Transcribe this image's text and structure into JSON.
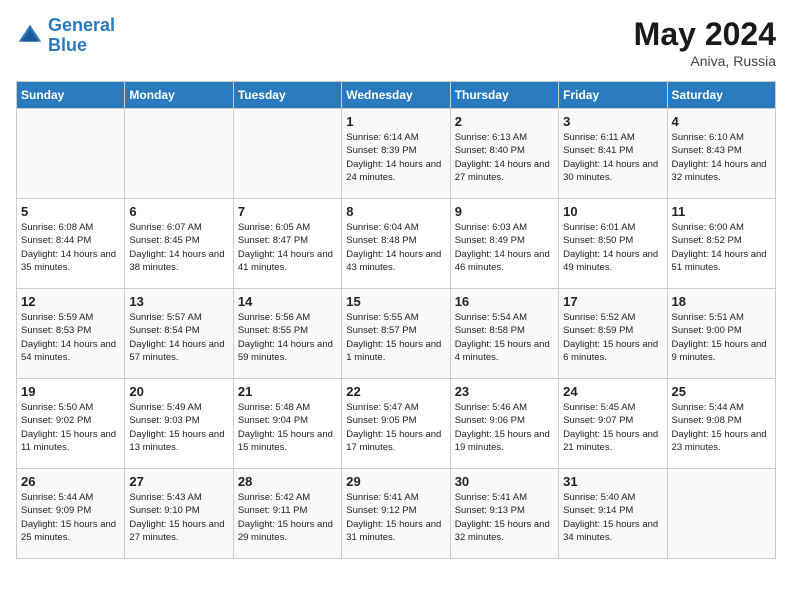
{
  "header": {
    "logo_line1": "General",
    "logo_line2": "Blue",
    "month_year": "May 2024",
    "location": "Aniva, Russia"
  },
  "days_of_week": [
    "Sunday",
    "Monday",
    "Tuesday",
    "Wednesday",
    "Thursday",
    "Friday",
    "Saturday"
  ],
  "weeks": [
    [
      {
        "date": "",
        "info": ""
      },
      {
        "date": "",
        "info": ""
      },
      {
        "date": "",
        "info": ""
      },
      {
        "date": "1",
        "info": "Sunrise: 6:14 AM\nSunset: 8:39 PM\nDaylight: 14 hours and 24 minutes."
      },
      {
        "date": "2",
        "info": "Sunrise: 6:13 AM\nSunset: 8:40 PM\nDaylight: 14 hours and 27 minutes."
      },
      {
        "date": "3",
        "info": "Sunrise: 6:11 AM\nSunset: 8:41 PM\nDaylight: 14 hours and 30 minutes."
      },
      {
        "date": "4",
        "info": "Sunrise: 6:10 AM\nSunset: 8:43 PM\nDaylight: 14 hours and 32 minutes."
      }
    ],
    [
      {
        "date": "5",
        "info": "Sunrise: 6:08 AM\nSunset: 8:44 PM\nDaylight: 14 hours and 35 minutes."
      },
      {
        "date": "6",
        "info": "Sunrise: 6:07 AM\nSunset: 8:45 PM\nDaylight: 14 hours and 38 minutes."
      },
      {
        "date": "7",
        "info": "Sunrise: 6:05 AM\nSunset: 8:47 PM\nDaylight: 14 hours and 41 minutes."
      },
      {
        "date": "8",
        "info": "Sunrise: 6:04 AM\nSunset: 8:48 PM\nDaylight: 14 hours and 43 minutes."
      },
      {
        "date": "9",
        "info": "Sunrise: 6:03 AM\nSunset: 8:49 PM\nDaylight: 14 hours and 46 minutes."
      },
      {
        "date": "10",
        "info": "Sunrise: 6:01 AM\nSunset: 8:50 PM\nDaylight: 14 hours and 49 minutes."
      },
      {
        "date": "11",
        "info": "Sunrise: 6:00 AM\nSunset: 8:52 PM\nDaylight: 14 hours and 51 minutes."
      }
    ],
    [
      {
        "date": "12",
        "info": "Sunrise: 5:59 AM\nSunset: 8:53 PM\nDaylight: 14 hours and 54 minutes."
      },
      {
        "date": "13",
        "info": "Sunrise: 5:57 AM\nSunset: 8:54 PM\nDaylight: 14 hours and 57 minutes."
      },
      {
        "date": "14",
        "info": "Sunrise: 5:56 AM\nSunset: 8:55 PM\nDaylight: 14 hours and 59 minutes."
      },
      {
        "date": "15",
        "info": "Sunrise: 5:55 AM\nSunset: 8:57 PM\nDaylight: 15 hours and 1 minute."
      },
      {
        "date": "16",
        "info": "Sunrise: 5:54 AM\nSunset: 8:58 PM\nDaylight: 15 hours and 4 minutes."
      },
      {
        "date": "17",
        "info": "Sunrise: 5:52 AM\nSunset: 8:59 PM\nDaylight: 15 hours and 6 minutes."
      },
      {
        "date": "18",
        "info": "Sunrise: 5:51 AM\nSunset: 9:00 PM\nDaylight: 15 hours and 9 minutes."
      }
    ],
    [
      {
        "date": "19",
        "info": "Sunrise: 5:50 AM\nSunset: 9:02 PM\nDaylight: 15 hours and 11 minutes."
      },
      {
        "date": "20",
        "info": "Sunrise: 5:49 AM\nSunset: 9:03 PM\nDaylight: 15 hours and 13 minutes."
      },
      {
        "date": "21",
        "info": "Sunrise: 5:48 AM\nSunset: 9:04 PM\nDaylight: 15 hours and 15 minutes."
      },
      {
        "date": "22",
        "info": "Sunrise: 5:47 AM\nSunset: 9:05 PM\nDaylight: 15 hours and 17 minutes."
      },
      {
        "date": "23",
        "info": "Sunrise: 5:46 AM\nSunset: 9:06 PM\nDaylight: 15 hours and 19 minutes."
      },
      {
        "date": "24",
        "info": "Sunrise: 5:45 AM\nSunset: 9:07 PM\nDaylight: 15 hours and 21 minutes."
      },
      {
        "date": "25",
        "info": "Sunrise: 5:44 AM\nSunset: 9:08 PM\nDaylight: 15 hours and 23 minutes."
      }
    ],
    [
      {
        "date": "26",
        "info": "Sunrise: 5:44 AM\nSunset: 9:09 PM\nDaylight: 15 hours and 25 minutes."
      },
      {
        "date": "27",
        "info": "Sunrise: 5:43 AM\nSunset: 9:10 PM\nDaylight: 15 hours and 27 minutes."
      },
      {
        "date": "28",
        "info": "Sunrise: 5:42 AM\nSunset: 9:11 PM\nDaylight: 15 hours and 29 minutes."
      },
      {
        "date": "29",
        "info": "Sunrise: 5:41 AM\nSunset: 9:12 PM\nDaylight: 15 hours and 31 minutes."
      },
      {
        "date": "30",
        "info": "Sunrise: 5:41 AM\nSunset: 9:13 PM\nDaylight: 15 hours and 32 minutes."
      },
      {
        "date": "31",
        "info": "Sunrise: 5:40 AM\nSunset: 9:14 PM\nDaylight: 15 hours and 34 minutes."
      },
      {
        "date": "",
        "info": ""
      }
    ]
  ]
}
